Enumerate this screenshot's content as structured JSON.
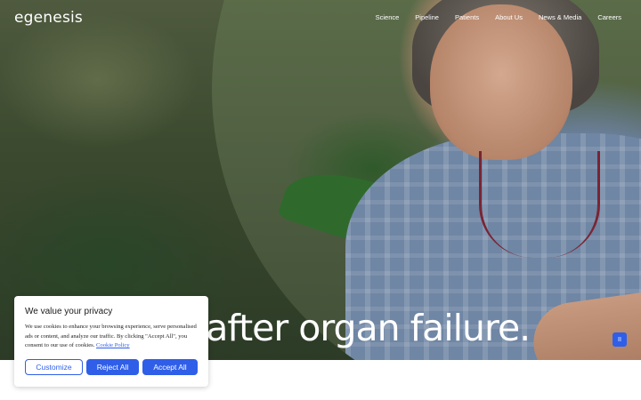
{
  "header": {
    "logo_text": "egenesis",
    "nav": [
      "Science",
      "Pipeline",
      "Patients",
      "About Us",
      "News & Media",
      "Careers"
    ]
  },
  "hero": {
    "headline_visible": "e after organ failure."
  },
  "controls": {
    "pause_glyph": "II"
  },
  "cookie_banner": {
    "title": "We value your privacy",
    "body_text": "We use cookies to enhance your browsing experience, serve personalised ads or content, and analyze our traffic. By clicking \"Accept All\", you consent to our use of cookies.",
    "policy_link": "Cookie Policy",
    "buttons": {
      "customize": "Customize",
      "reject": "Reject All",
      "accept": "Accept All"
    }
  },
  "colors": {
    "accent": "#2f5fe8",
    "hero_bg": "#3c4a2f",
    "text_white": "#ffffff"
  },
  "icons": {
    "pause": "pause-icon"
  }
}
